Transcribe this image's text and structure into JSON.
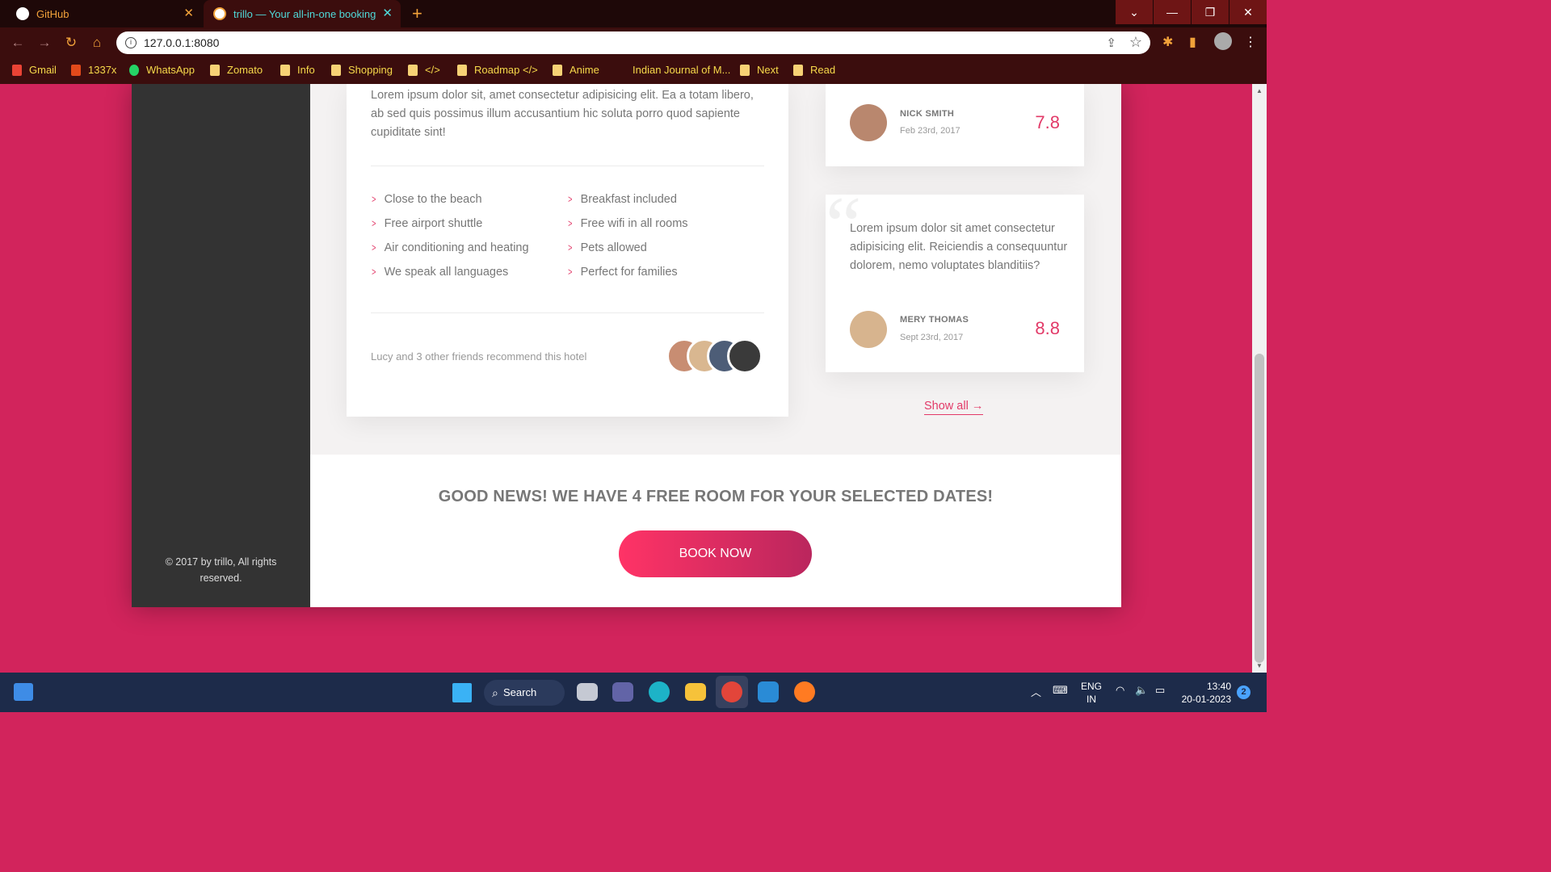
{
  "browser": {
    "tabs": [
      {
        "title": "GitHub",
        "active": false
      },
      {
        "title": "trillo — Your all-in-one booking app",
        "active": true
      }
    ],
    "address": "127.0.0.1:8080",
    "bookmarks": [
      "Gmail",
      "1337x",
      "WhatsApp",
      "Zomato",
      "Info",
      "Shopping",
      "</>",
      "Roadmap </>",
      "Anime",
      "Indian Journal of M...",
      "Next",
      "Read"
    ]
  },
  "sidebar": {
    "copyright": "© 2017 by trillo, All rights reserved."
  },
  "description": {
    "text": "Lorem ipsum dolor sit, amet consectetur adipisicing elit. Ea a totam libero, ab sed quis possimus illum accusantium hic soluta porro quod sapiente cupiditate sint!",
    "features": [
      "Close to the beach",
      "Breakfast included",
      "Free airport shuttle",
      "Free wifi in all rooms",
      "Air conditioning and heating",
      "Pets allowed",
      "We speak all languages",
      "Perfect for families"
    ],
    "recommend": "Lucy and 3 other friends recommend this hotel"
  },
  "reviews": [
    {
      "name": "Nick Smith",
      "date": "Feb 23rd, 2017",
      "rating": "7.8"
    },
    {
      "text": "Lorem ipsum dolor sit amet consectetur adipisicing elit. Reiciendis a consequuntur dolorem, nemo voluptates blanditiis?",
      "name": "Mery Thomas",
      "date": "Sept 23rd, 2017",
      "rating": "8.8"
    }
  ],
  "show_all": "Show all →",
  "cta": {
    "title": "Good news! We have 4 free room for your selected dates!",
    "button": "Book now"
  },
  "taskbar": {
    "search": "Search",
    "lang": [
      "ENG",
      "IN"
    ],
    "time": "13:40",
    "date": "20-01-2023",
    "notifications": "2"
  },
  "colors": {
    "primary": "#d2245c",
    "accent": "#e23a68",
    "sidebar": "#333333"
  }
}
